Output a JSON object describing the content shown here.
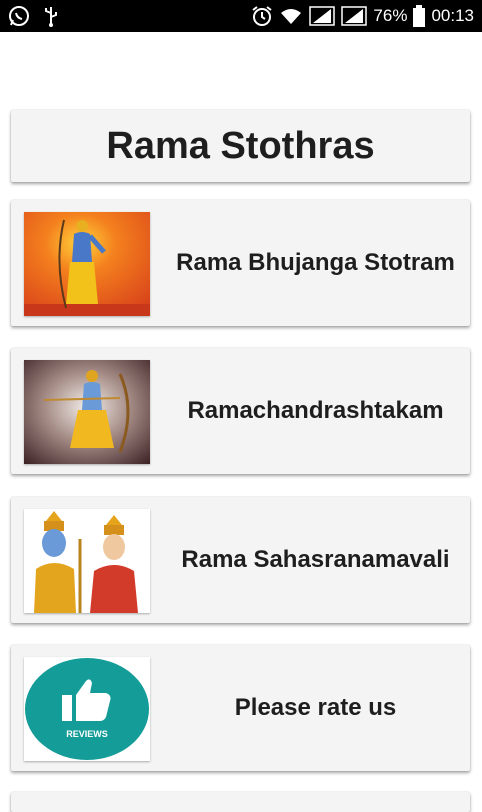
{
  "status_bar": {
    "battery_percent": "76%",
    "time": "00:13",
    "left_icons": [
      "whatsapp-icon",
      "usb-icon"
    ],
    "right_icons": [
      "alarm-icon",
      "wifi-icon",
      "signal-icon",
      "signal-icon",
      "battery-icon"
    ]
  },
  "header": {
    "title": "Rama Stothras"
  },
  "items": [
    {
      "label": "Rama Bhujanga Stotram",
      "thumb": "rama-image"
    },
    {
      "label": "Ramachandrashtakam",
      "thumb": "rama-bow-image"
    },
    {
      "label": "Rama Sahasranamavali",
      "thumb": "rama-sita-image"
    },
    {
      "label": "Please rate us",
      "thumb": "reviews-thumbs-up-icon",
      "badge_text": "REVIEWS"
    }
  ],
  "colors": {
    "reviews_teal": "#149c98",
    "first_thumb_orange": "#f06a1c"
  }
}
